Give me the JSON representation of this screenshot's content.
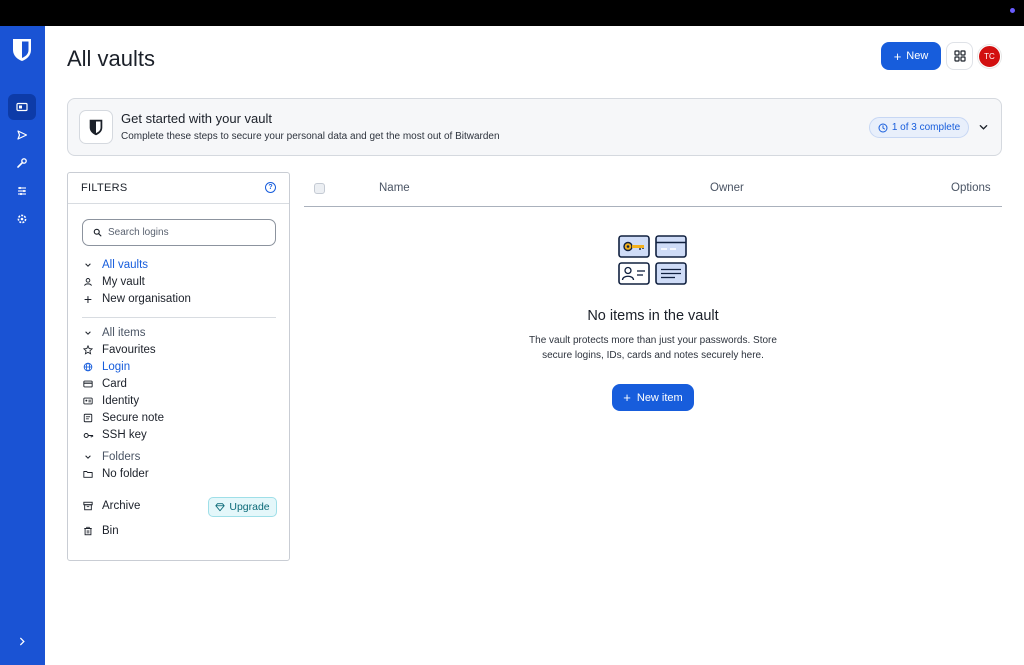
{
  "header": {
    "title": "All vaults",
    "new_label": "New",
    "avatar_initials": "TC"
  },
  "banner": {
    "title": "Get started with your vault",
    "subtitle": "Complete these steps to secure your personal data and get the most out of Bitwarden",
    "progress": "1 of 3 complete"
  },
  "filters": {
    "title": "FILTERS",
    "search_placeholder": "Search logins",
    "vaults": {
      "header": "All vaults",
      "items": [
        "My vault",
        "New organisation"
      ]
    },
    "types": {
      "header": "All items",
      "items": [
        "Favourites",
        "Login",
        "Card",
        "Identity",
        "Secure note",
        "SSH key"
      ]
    },
    "folders": {
      "header": "Folders",
      "items": [
        "No folder"
      ]
    },
    "archive_label": "Archive",
    "upgrade_label": "Upgrade",
    "bin_label": "Bin"
  },
  "table": {
    "columns": [
      "Name",
      "Owner",
      "Options"
    ]
  },
  "empty_state": {
    "title": "No items in the vault",
    "description": "The vault protects more than just your passwords. Store secure logins, IDs, cards and notes securely here.",
    "button_label": "New item"
  },
  "colors": {
    "brand": "#175ddc",
    "sidebar": "#1a53d4",
    "avatar": "#d20f0f",
    "upgrade_bg": "#e4f7fa"
  },
  "icons": {
    "sidebar": [
      "vault-icon",
      "send-icon",
      "tools-icon",
      "reports-icon",
      "settings-icon"
    ]
  }
}
